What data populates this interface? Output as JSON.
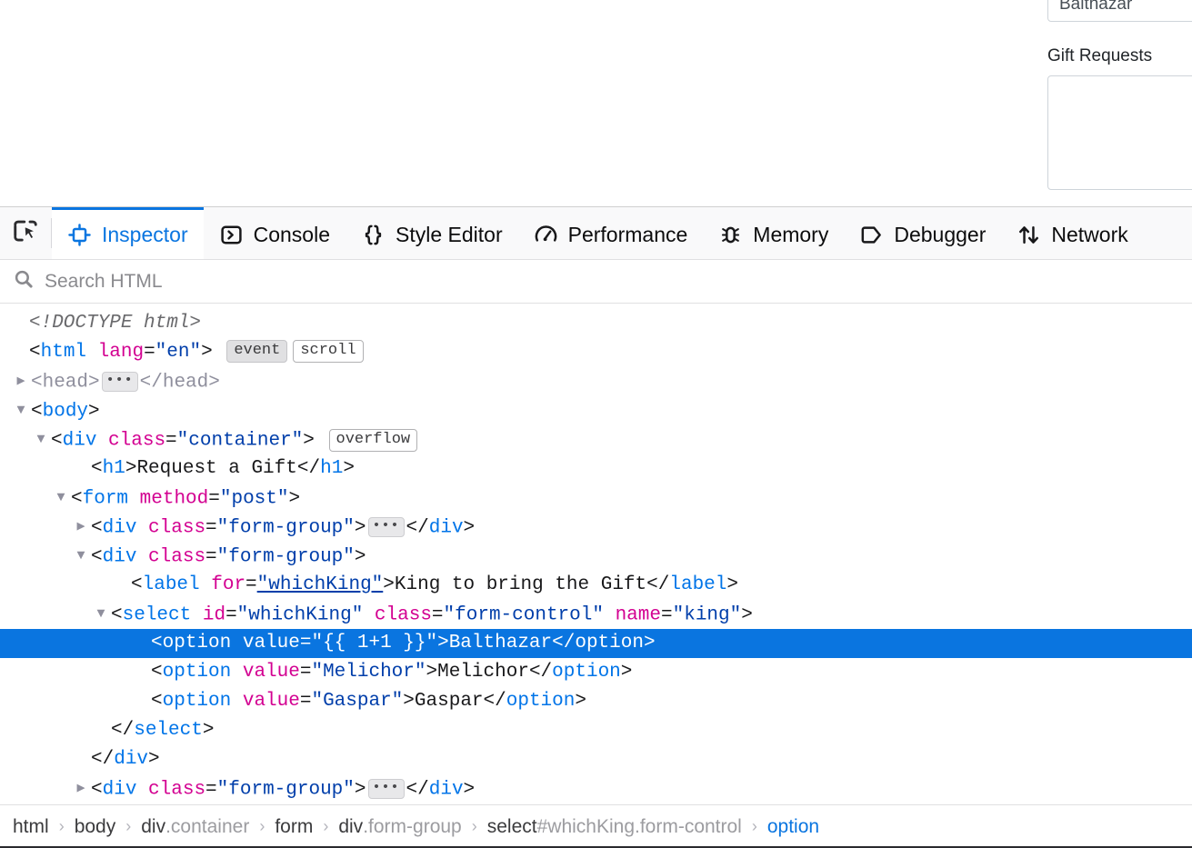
{
  "page": {
    "select_value": "Balthazar",
    "gift_requests_label": "Gift Requests",
    "textarea_value": ""
  },
  "devtools": {
    "picker": {
      "name": "element-picker",
      "icon": "pick-element-icon"
    },
    "tabs": [
      {
        "id": "inspector",
        "label": "Inspector",
        "icon": "inspector-icon",
        "active": true
      },
      {
        "id": "console",
        "label": "Console",
        "icon": "console-icon",
        "active": false
      },
      {
        "id": "style-editor",
        "label": "Style Editor",
        "icon": "style-editor-icon",
        "active": false
      },
      {
        "id": "performance",
        "label": "Performance",
        "icon": "performance-icon",
        "active": false
      },
      {
        "id": "memory",
        "label": "Memory",
        "icon": "memory-icon",
        "active": false
      },
      {
        "id": "debugger",
        "label": "Debugger",
        "icon": "debugger-icon",
        "active": false
      },
      {
        "id": "network",
        "label": "Network",
        "icon": "network-icon",
        "active": false
      }
    ],
    "search": {
      "icon": "search-icon",
      "placeholder": "Search HTML",
      "value": ""
    },
    "markup": {
      "doctype": "<!DOCTYPE html>",
      "html_tag": "html",
      "html_attr_name": "lang",
      "html_attr_value": "\"en\"",
      "badge_event": "event",
      "badge_scroll": "scroll",
      "head_open": "<head>",
      "head_close": "</head>",
      "ellipsis": "•••",
      "body_tag": "body",
      "container_tag": "div",
      "container_attr": "class",
      "container_value": "\"container\"",
      "badge_overflow": "overflow",
      "h1_tag": "h1",
      "h1_text": "Request a Gift",
      "form_tag": "form",
      "form_attr": "method",
      "form_value": "\"post\"",
      "formgroup_tag": "div",
      "formgroup_attr": "class",
      "formgroup_value": "\"form-group\"",
      "label_tag": "label",
      "label_attr": "for",
      "label_attr_value": "\"whichKing\"",
      "label_text": "King to bring the Gift",
      "select_tag": "select",
      "select_id_attr": "id",
      "select_id_value": "\"whichKing\"",
      "select_class_attr": "class",
      "select_class_value": "\"form-control\"",
      "select_name_attr": "name",
      "select_name_value": "\"king\"",
      "option_tag": "option",
      "option_value_attr": "value",
      "options": [
        {
          "value": "\"{{ 1+1 }}\"",
          "text": "Balthazar",
          "selected": true
        },
        {
          "value": "\"Melichor\"",
          "text": "Melichor",
          "selected": false
        },
        {
          "value": "\"Gaspar\"",
          "text": "Gaspar",
          "selected": false
        }
      ]
    },
    "breadcrumb": [
      {
        "element": "html",
        "modifier": "",
        "selected": false
      },
      {
        "element": "body",
        "modifier": "",
        "selected": false
      },
      {
        "element": "div",
        "modifier": ".container",
        "selected": false
      },
      {
        "element": "form",
        "modifier": "",
        "selected": false
      },
      {
        "element": "div",
        "modifier": ".form-group",
        "selected": false
      },
      {
        "element": "select",
        "modifier": "#whichKing.form-control",
        "selected": false
      },
      {
        "element": "option",
        "modifier": "",
        "selected": true
      }
    ],
    "breadcrumb_separator": "›",
    "colors": {
      "accent": "#0a75e0",
      "tag": "#0074e8",
      "attribute_name": "#d30091",
      "attribute_value": "#003eaa",
      "toolbar_bg": "#f9f9fa",
      "selection_bg": "#0a75e0"
    }
  }
}
